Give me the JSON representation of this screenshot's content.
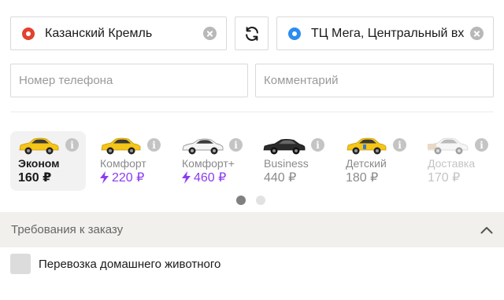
{
  "route": {
    "from": "Казанский Кремль",
    "to": "ТЦ Мега, Центральный вхо"
  },
  "form": {
    "phone_placeholder": "Номер телефона",
    "comment_placeholder": "Комментарий"
  },
  "tariffs": [
    {
      "name": "Эконом",
      "price": "160 ₽",
      "state": "selected",
      "surge": false,
      "car_color": "#f5c518"
    },
    {
      "name": "Комфорт",
      "price": "220 ₽",
      "state": "normal",
      "surge": true,
      "car_color": "#f5c518"
    },
    {
      "name": "Комфорт+",
      "price": "460 ₽",
      "state": "normal",
      "surge": true,
      "car_color": "#f2f2f2"
    },
    {
      "name": "Business",
      "price": "440 ₽",
      "state": "normal",
      "surge": false,
      "car_color": "#2b2b2b"
    },
    {
      "name": "Детский",
      "price": "180 ₽",
      "state": "normal",
      "surge": false,
      "car_color": "#f5c518"
    },
    {
      "name": "Доставка",
      "price": "170 ₽",
      "state": "disabled",
      "surge": false,
      "car_color": "#eeeeee"
    }
  ],
  "pager": {
    "pages": 2,
    "current": 1
  },
  "requirements": {
    "title": "Требования к заказу",
    "options": [
      {
        "label": "Перевозка домашнего животного",
        "checked": false
      }
    ]
  },
  "colors": {
    "from_dot": "#e3412f",
    "to_dot": "#2d8cf0",
    "surge_price": "#8b3cf0",
    "requirements_bg": "#f1f0ed"
  },
  "icons": {
    "from": "red-pin-dot-icon",
    "to": "blue-pin-dot-icon",
    "clear": "clear-icon",
    "swap": "swap-route-icon",
    "info": "info-icon",
    "surge": "lightning-icon",
    "collapse": "chevron-up-icon"
  }
}
